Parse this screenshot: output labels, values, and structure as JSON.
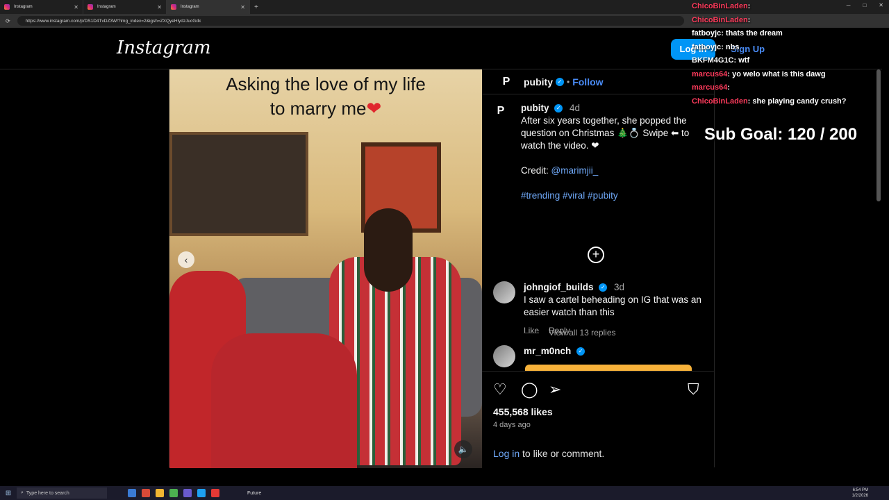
{
  "browser": {
    "tabs": [
      {
        "label": "Instagram"
      },
      {
        "label": "Instagram"
      },
      {
        "label": "Instagram"
      }
    ],
    "new_tab_label": "+",
    "url": "https://www.instagram.com/p/DS1D4TvDZ3W/?img_index=2&igsh=ZXQyeHlydzJucGdk"
  },
  "header": {
    "logo": "Instagram",
    "login_label": "Log In",
    "signup_label": "Sign Up"
  },
  "post": {
    "overlay_caption_line1": "Asking the love of my life",
    "overlay_caption_line2": "to marry me",
    "overlay_heart": "❤",
    "author": "pubity",
    "follow_label": "Follow",
    "caption_time": "4d",
    "caption_text": "After six years together, she popped the question on Christmas 🎄💍 Swipe ⬅ to watch the video. ❤",
    "credit_label": "Credit:",
    "credit_handle": "@marimjii_",
    "hashtags": "#trending #viral #pubity",
    "likes": "455,568 likes",
    "posted_ago": "4 days ago",
    "login_link": "Log in",
    "login_suffix": "to like or comment."
  },
  "comments": [
    {
      "user": "johngiof_builds",
      "time": "3d",
      "text": "I saw a cartel beheading on IG that was an easier watch than this",
      "like_label": "Like",
      "reply_label": "Reply",
      "view_replies": "View all 13 replies"
    },
    {
      "user": "mr_m0nch"
    }
  ],
  "chat": [
    {
      "user": "ChicoBinLaden",
      "msg": ""
    },
    {
      "user": "ChicoBinLaden",
      "msg": ""
    },
    {
      "user": "fatboyjc",
      "msg": "thats the dream"
    },
    {
      "user": "fatboyjc",
      "msg": "nbs"
    },
    {
      "user": "BKFM4G1C",
      "msg": "wtf"
    },
    {
      "user": "marcus64",
      "msg": "yo welo what is this dawg"
    },
    {
      "user": "marcus64",
      "msg": ""
    },
    {
      "user": "ChicoBinLaden",
      "msg": "she playing candy crush?"
    }
  ],
  "stream": {
    "sub_goal": "Sub Goal:  120 / 200"
  },
  "taskbar": {
    "search_placeholder": "Type here to search",
    "future_label": "Future",
    "time": "6:54 PM",
    "date": "1/2/2026"
  },
  "colors": {
    "instagram_blue": "#0095f6",
    "chat_user": "#ff3b5c",
    "background": "#000000"
  }
}
